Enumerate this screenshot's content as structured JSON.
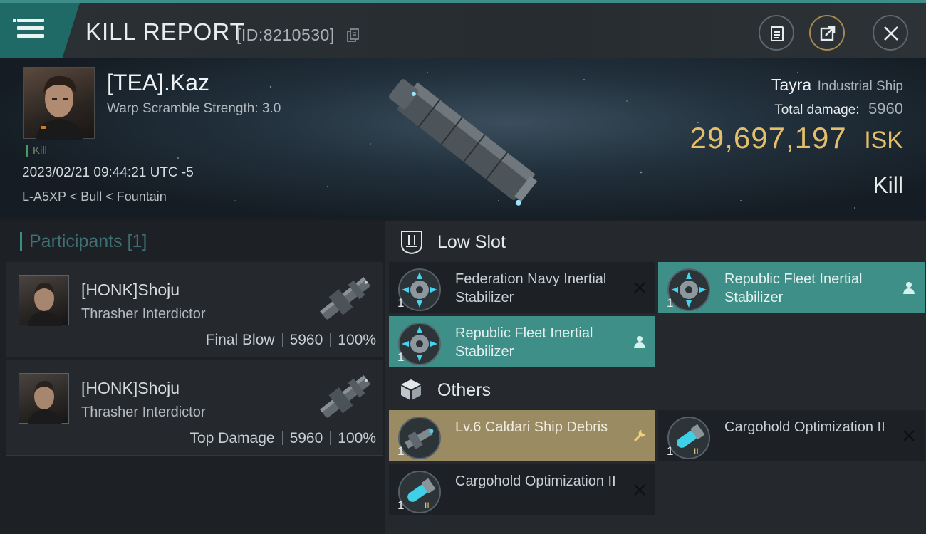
{
  "header": {
    "title": "KILL REPORT",
    "report_id": "[ID:8210530]"
  },
  "victim": {
    "name": "[TEA].Kaz",
    "warp_scramble": "Warp Scramble Strength: 3.0",
    "kill_tag": "Kill",
    "datetime": "2023/02/21 09:44:21 UTC -5",
    "location": "L-A5XP < Bull < Fountain",
    "ship_name": "Tayra",
    "ship_class": "Industrial Ship",
    "damage_label": "Total damage:",
    "damage_value": "5960",
    "isk_value": "29,697,197",
    "isk_unit": "ISK",
    "result": "Kill"
  },
  "participants": {
    "header": "Participants [1]",
    "items": [
      {
        "name": "[HONK]Shoju",
        "ship": "Thrasher Interdictor",
        "role": "Final Blow",
        "damage": "5960",
        "percent": "100%"
      },
      {
        "name": "[HONK]Shoju",
        "ship": "Thrasher Interdictor",
        "role": "Top Damage",
        "damage": "5960",
        "percent": "100%"
      }
    ]
  },
  "low_slot": {
    "title": "Low Slot",
    "items": [
      {
        "label": "Federation Navy Inertial Stabilizer",
        "qty": "1",
        "status": "destroyed",
        "icon": "inertial-stabilizer-icon"
      },
      {
        "label": "Republic Fleet Inertial Stabilizer",
        "qty": "1",
        "status": "dropped",
        "icon": "inertial-stabilizer-icon"
      },
      {
        "label": "Republic Fleet Inertial Stabilizer",
        "qty": "1",
        "status": "dropped",
        "icon": "inertial-stabilizer-icon"
      }
    ]
  },
  "others": {
    "title": "Others",
    "items": [
      {
        "label": "Lv.6 Caldari Ship Debris",
        "qty": "1",
        "status": "salvage",
        "icon": "ship-debris-icon"
      },
      {
        "label": "Cargohold Optimization II",
        "qty": "1",
        "status": "destroyed",
        "icon": "cargohold-optimization-icon"
      },
      {
        "label": "Cargohold Optimization II",
        "qty": "1",
        "status": "destroyed",
        "icon": "cargohold-optimization-icon"
      }
    ]
  },
  "colors": {
    "accent_teal": "#3f8f89",
    "isk_gold": "#e4bf6a",
    "salvage_gold": "#9a8b62"
  }
}
